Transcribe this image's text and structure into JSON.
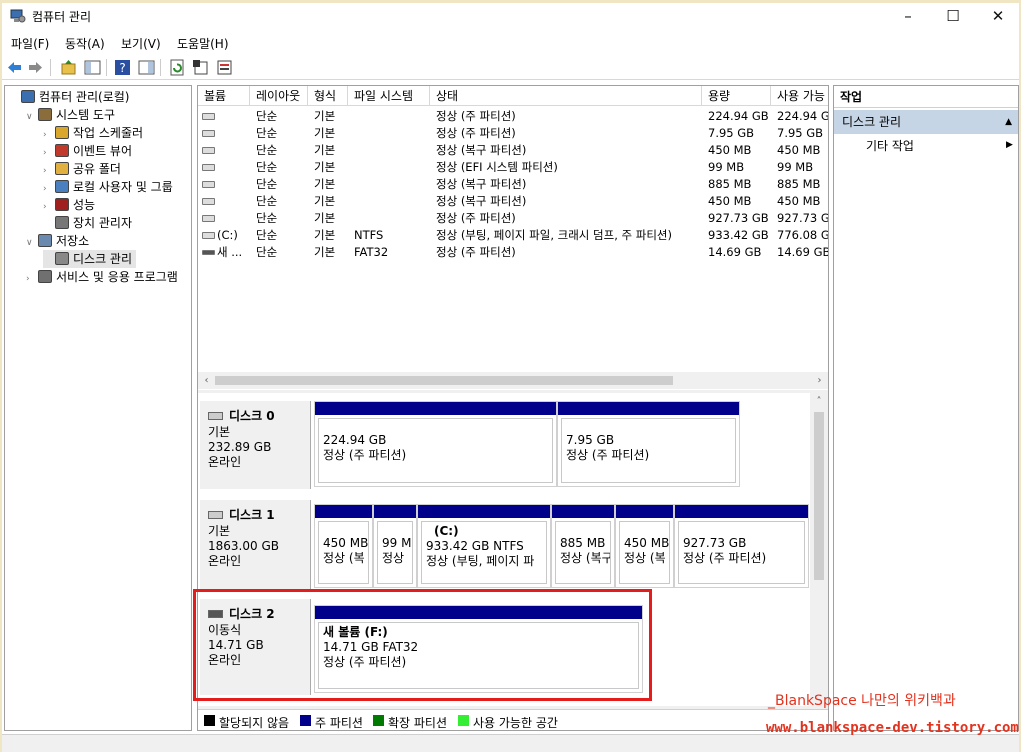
{
  "window": {
    "title": "컴퓨터 관리"
  },
  "menu": [
    "파일(F)",
    "동작(A)",
    "보기(V)",
    "도움말(H)"
  ],
  "toolbar": [
    "back-icon",
    "forward-icon",
    "up-icon",
    "show-hide-tree-icon",
    "help-icon",
    "show-hide-action-icon",
    "refresh-icon",
    "properties-icon",
    "export-icon"
  ],
  "tree": [
    {
      "label": "컴퓨터 관리(로컬)",
      "icon": "computer-management-icon",
      "toggle": "",
      "indent": 0
    },
    {
      "label": "시스템 도구",
      "icon": "system-tools-icon",
      "toggle": "∨",
      "indent": 1
    },
    {
      "label": "작업 스케줄러",
      "icon": "task-scheduler-icon",
      "toggle": "›",
      "indent": 2
    },
    {
      "label": "이벤트 뷰어",
      "icon": "event-viewer-icon",
      "toggle": "›",
      "indent": 2
    },
    {
      "label": "공유 폴더",
      "icon": "shared-folders-icon",
      "toggle": "›",
      "indent": 2
    },
    {
      "label": "로컬 사용자 및 그룹",
      "icon": "local-users-icon",
      "toggle": "›",
      "indent": 2
    },
    {
      "label": "성능",
      "icon": "performance-icon",
      "toggle": "›",
      "indent": 2
    },
    {
      "label": "장치 관리자",
      "icon": "device-manager-icon",
      "toggle": "",
      "indent": 2
    },
    {
      "label": "저장소",
      "icon": "storage-icon",
      "toggle": "∨",
      "indent": 1
    },
    {
      "label": "디스크 관리",
      "icon": "disk-management-icon",
      "toggle": "",
      "indent": 2,
      "selected": true
    },
    {
      "label": "서비스 및 응용 프로그램",
      "icon": "services-icon",
      "toggle": "›",
      "indent": 1
    }
  ],
  "volume_list": {
    "columns": [
      "볼륨",
      "레이아웃",
      "형식",
      "파일 시스템",
      "상태",
      "용량",
      "사용 가능"
    ],
    "rows": [
      [
        "",
        "단순",
        "기본",
        "",
        "정상 (주 파티션)",
        "224.94 GB",
        "224.94 G"
      ],
      [
        "",
        "단순",
        "기본",
        "",
        "정상 (주 파티션)",
        "7.95 GB",
        "7.95 GB"
      ],
      [
        "",
        "단순",
        "기본",
        "",
        "정상 (복구 파티션)",
        "450 MB",
        "450 MB"
      ],
      [
        "",
        "단순",
        "기본",
        "",
        "정상 (EFI 시스템 파티션)",
        "99 MB",
        "99 MB"
      ],
      [
        "",
        "단순",
        "기본",
        "",
        "정상 (복구 파티션)",
        "885 MB",
        "885 MB"
      ],
      [
        "",
        "단순",
        "기본",
        "",
        "정상 (복구 파티션)",
        "450 MB",
        "450 MB"
      ],
      [
        "",
        "단순",
        "기본",
        "",
        "정상 (주 파티션)",
        "927.73 GB",
        "927.73 G"
      ],
      [
        "(C:)",
        "단순",
        "기본",
        "NTFS",
        "정상 (부팅, 페이지 파일, 크래시 덤프, 주 파티션)",
        "933.42 GB",
        "776.08 G"
      ],
      [
        "새 ...",
        "단순",
        "기본",
        "FAT32",
        "정상 (주 파티션)",
        "14.69 GB",
        "14.69 GB"
      ]
    ]
  },
  "disks": [
    {
      "name": "디스크 0",
      "type": "기본",
      "size": "232.89 GB",
      "status": "온라인",
      "partitions": [
        {
          "label": "",
          "size": "224.94 GB",
          "status": "정상 (주 파티션)"
        },
        {
          "label": "",
          "size": "7.95 GB",
          "status": "정상 (주 파티션)"
        }
      ]
    },
    {
      "name": "디스크 1",
      "type": "기본",
      "size": "1863.00 GB",
      "status": "온라인",
      "partitions": [
        {
          "label": "",
          "size": "450 MB",
          "status": "정상 (복"
        },
        {
          "label": "",
          "size": "99 M",
          "status": "정상"
        },
        {
          "label": "(C:)",
          "size": "933.42 GB NTFS",
          "status": "정상 (부팅, 페이지 파"
        },
        {
          "label": "",
          "size": "885 MB",
          "status": "정상 (복구"
        },
        {
          "label": "",
          "size": "450 MB",
          "status": "정상 (복"
        },
        {
          "label": "",
          "size": "927.73 GB",
          "status": "정상 (주 파티션)"
        }
      ]
    },
    {
      "name": "디스크 2",
      "type": "이동식",
      "size": "14.71 GB",
      "status": "온라인",
      "partitions": [
        {
          "label": "새 볼륨  (F:)",
          "size": "14.71 GB FAT32",
          "status": "정상 (주 파티션)"
        }
      ]
    }
  ],
  "legend": [
    {
      "label": "할당되지 않음",
      "color": "#000000"
    },
    {
      "label": "주 파티션",
      "color": "#00008b"
    },
    {
      "label": "확장 파티션",
      "color": "#007a00"
    },
    {
      "label": "사용 가능한 공간",
      "color": "#33ee33"
    }
  ],
  "actions": {
    "header": "작업",
    "section": "디스크 관리",
    "item": "기타 작업"
  },
  "watermark": {
    "line1": "_BlankSpace 나만의 위키백과",
    "line2": "www.blankspace-dev.tistory.com"
  },
  "colors": {
    "primary_partition": "#00008b",
    "selection": "#c6d5e6",
    "highlight_box": "#e51c1c"
  }
}
